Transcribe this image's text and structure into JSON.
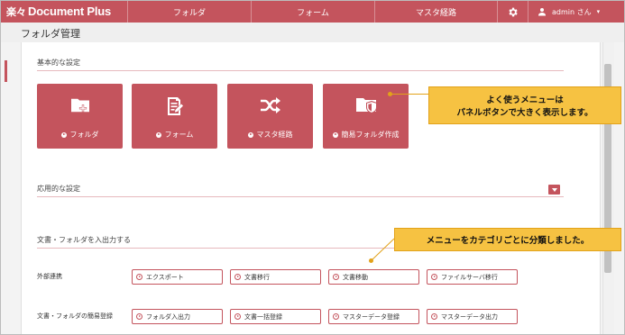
{
  "app": {
    "logo_kanji": "楽々",
    "logo_text": "Document Plus",
    "brand_color": "#c4545d"
  },
  "nav": {
    "items": [
      "フォルダ",
      "フォーム",
      "マスタ経路"
    ]
  },
  "user": {
    "label": "admin さん"
  },
  "page": {
    "title": "フォルダ管理"
  },
  "sections": {
    "basic": "基本的な設定",
    "advanced": "応用的な設定",
    "io": "文書・フォルダを入出力する"
  },
  "panels": [
    {
      "label": "フォルダ",
      "icon": "folder-add-icon"
    },
    {
      "label": "フォーム",
      "icon": "form-edit-icon"
    },
    {
      "label": "マスタ経路",
      "icon": "shuffle-icon"
    },
    {
      "label": "簡易フォルダ作成",
      "icon": "folder-shield-icon"
    }
  ],
  "io_rows": [
    {
      "label": "外部連携",
      "buttons": [
        "エクスポート",
        "文書移行",
        "文書移動",
        "ファイルサーバ移行"
      ]
    },
    {
      "label": "文書・フォルダの簡易登録",
      "buttons": [
        "フォルダ入出力",
        "文書一括登録",
        "マスターデータ登録",
        "マスターデータ出力"
      ]
    }
  ],
  "callouts": {
    "panel_note": [
      "よく使うメニューは",
      "パネルボタンで大きく表示します。"
    ],
    "category_note": "メニューをカテゴリごとに分類しました。",
    "color": "#f6c242"
  }
}
